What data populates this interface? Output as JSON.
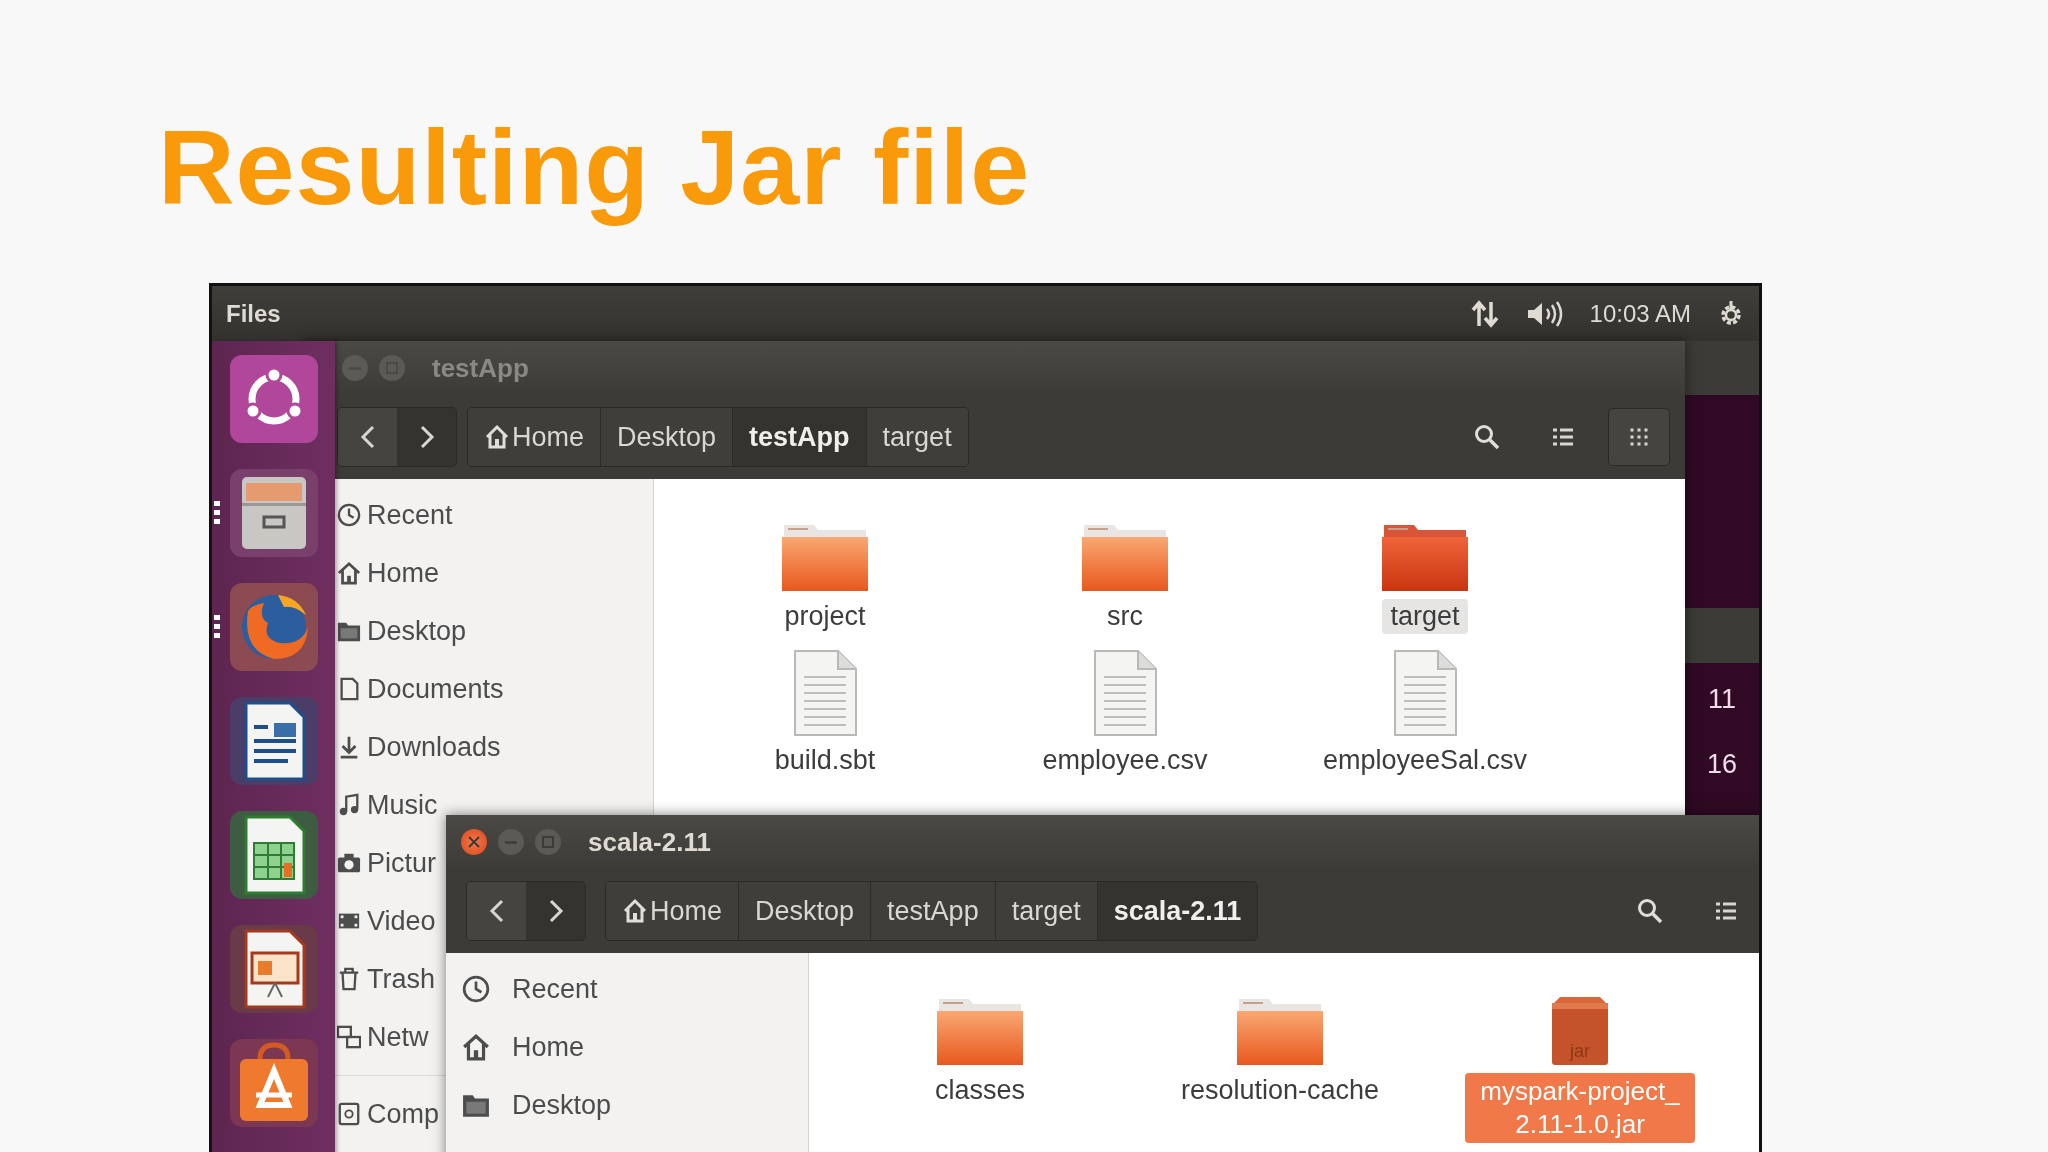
{
  "slide": {
    "title": "Resulting Jar file"
  },
  "top_panel": {
    "app_name": "Files",
    "clock": "10:03 AM"
  },
  "launcher": {
    "items": [
      {
        "kind": "ubuntu",
        "running": false
      },
      {
        "kind": "files",
        "running": true
      },
      {
        "kind": "browser",
        "running": true
      },
      {
        "kind": "writer",
        "running": false
      },
      {
        "kind": "calc",
        "running": false
      },
      {
        "kind": "impress",
        "running": false
      },
      {
        "kind": "software",
        "running": false
      }
    ]
  },
  "terminal": {
    "lines": [
      "11",
      "16"
    ]
  },
  "windows": [
    {
      "title": "testApp",
      "active": false,
      "title_buttons": [
        {
          "kind": "minimize"
        },
        {
          "kind": "maximize"
        }
      ],
      "breadcrumbs": [
        {
          "label": "Home",
          "kind": "home",
          "selected": false
        },
        {
          "label": "Desktop",
          "kind": "folder",
          "selected": false
        },
        {
          "label": "testApp",
          "kind": "folder",
          "selected": true
        },
        {
          "label": "target",
          "kind": "folder",
          "selected": false
        }
      ],
      "view_buttons": [
        {
          "kind": "list",
          "selected": false
        },
        {
          "kind": "grid",
          "selected": true
        }
      ],
      "sidebar": {
        "places": [
          {
            "label": "Recent",
            "kind": "recent"
          },
          {
            "label": "Home",
            "kind": "home"
          },
          {
            "label": "Desktop",
            "kind": "desktop"
          },
          {
            "label": "Documents",
            "kind": "documents"
          },
          {
            "label": "Downloads",
            "kind": "downloads"
          },
          {
            "label": "Music",
            "kind": "music"
          },
          {
            "label": "Pictur",
            "kind": "pictures"
          },
          {
            "label": "Video",
            "kind": "videos"
          },
          {
            "label": "Trash",
            "kind": "trash"
          },
          {
            "label": "Netw",
            "kind": "network"
          }
        ],
        "devices": [
          {
            "label": "Comp",
            "kind": "computer"
          }
        ]
      },
      "files": [
        {
          "name": "project",
          "kind": "folder",
          "selected": false
        },
        {
          "name": "src",
          "kind": "folder",
          "selected": false
        },
        {
          "name": "target",
          "kind": "folder",
          "selected": true
        },
        {
          "name": "build.sbt",
          "kind": "text",
          "selected": false
        },
        {
          "name": "employee.csv",
          "kind": "text",
          "selected": false
        },
        {
          "name": "employeeSal.csv",
          "kind": "text",
          "selected": false
        }
      ]
    },
    {
      "title": "scala-2.11",
      "active": true,
      "title_buttons": [
        {
          "kind": "close"
        },
        {
          "kind": "minimize"
        },
        {
          "kind": "maximize"
        }
      ],
      "breadcrumbs": [
        {
          "label": "Home",
          "kind": "home",
          "selected": false
        },
        {
          "label": "Desktop",
          "kind": "folder",
          "selected": false
        },
        {
          "label": "testApp",
          "kind": "folder",
          "selected": false
        },
        {
          "label": "target",
          "kind": "folder",
          "selected": false
        },
        {
          "label": "scala-2.11",
          "kind": "folder",
          "selected": true
        }
      ],
      "view_buttons": [
        {
          "kind": "list",
          "selected": false
        }
      ],
      "sidebar": {
        "places": [
          {
            "label": "Recent",
            "kind": "recent"
          },
          {
            "label": "Home",
            "kind": "home"
          },
          {
            "label": "Desktop",
            "kind": "desktop"
          }
        ]
      },
      "files": [
        {
          "name": "classes",
          "kind": "folder",
          "selected": false
        },
        {
          "name": "resolution-cache",
          "kind": "folder",
          "selected": false
        },
        {
          "name": "myspark-project_2.11-1.0.jar",
          "kind": "jar",
          "icon_label": "jar",
          "selected": true
        }
      ]
    }
  ]
}
